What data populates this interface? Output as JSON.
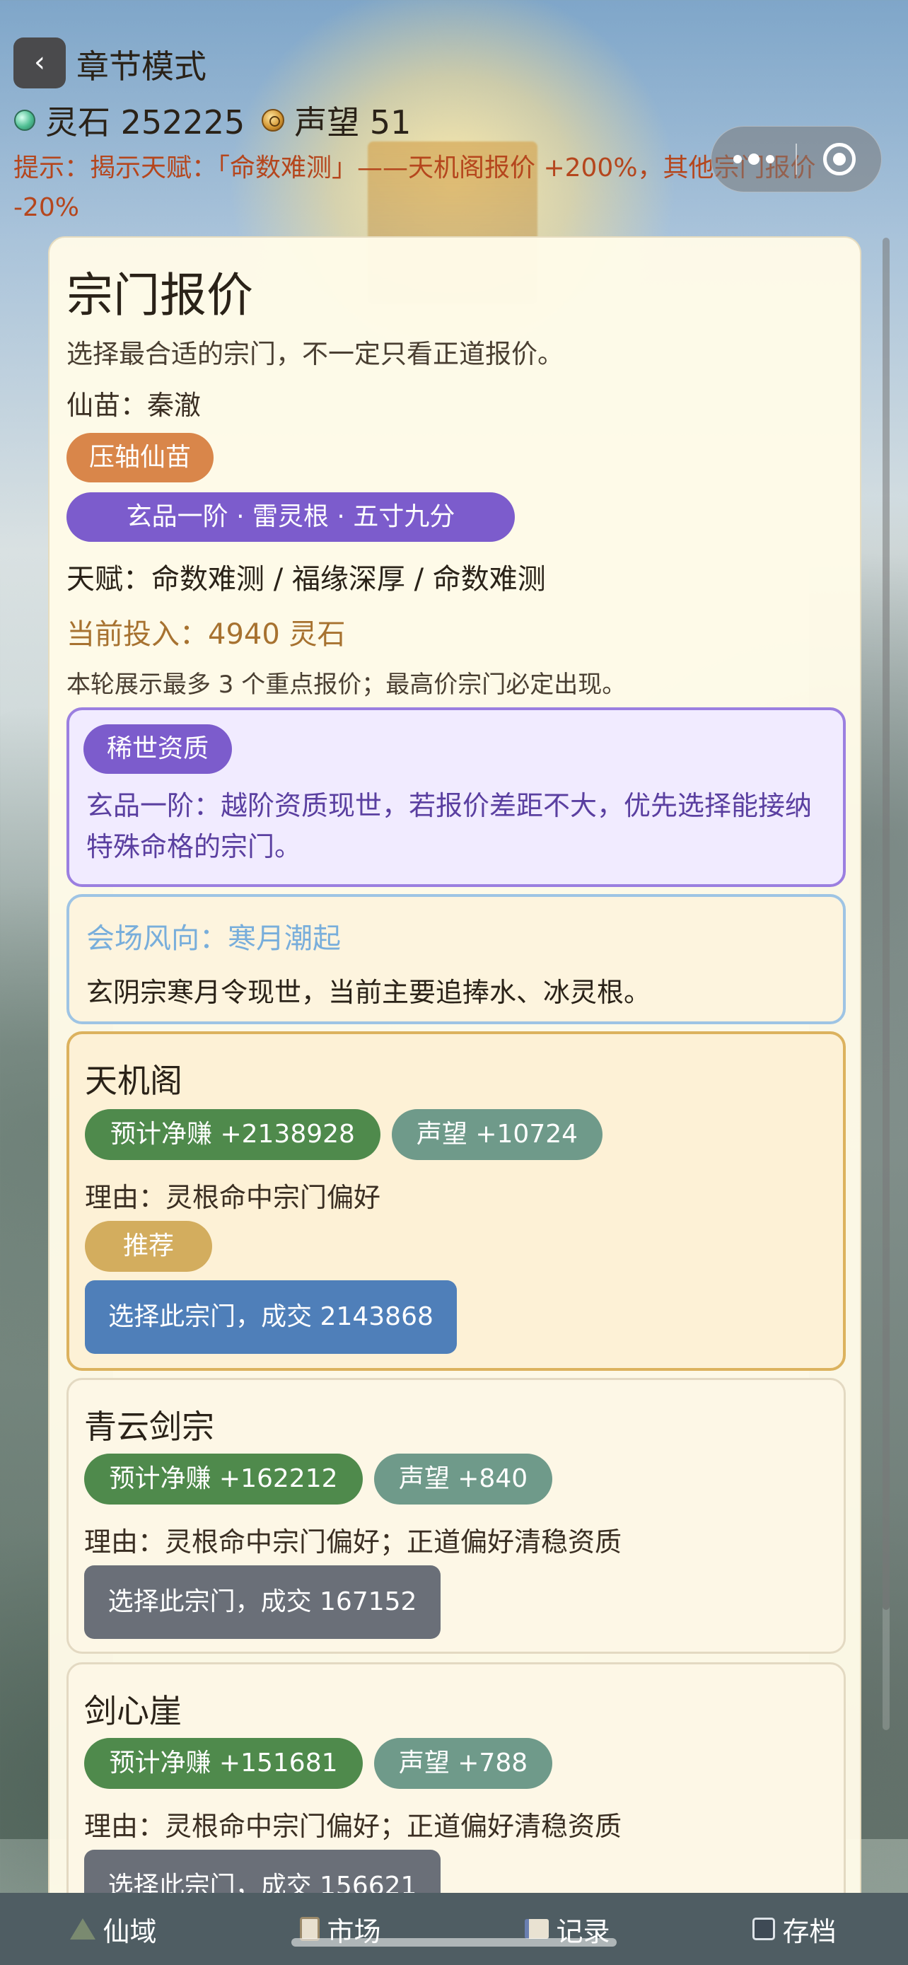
{
  "header": {
    "back_icon": "‹",
    "title": "章节模式",
    "spirit_stones": "灵石 252225",
    "reputation": "声望 51",
    "hint": "提示：揭示天赋：「命数难测」——天机阁报价 +200%，其他宗门报价 -20%"
  },
  "panel": {
    "title": "宗门报价",
    "description": "选择最合适的宗门，不一定只看正道报价。",
    "seedling": "仙苗：秦澈",
    "tag_primary": "压轴仙苗",
    "tag_grade": "玄品一阶 · 雷灵根 · 五寸九分",
    "talents": "天赋：命数难测 / 福缘深厚 / 命数难测",
    "current_invest": "当前投入：4940 灵石",
    "note": "本轮展示最多 3 个重点报价；最高价宗门必定出现。",
    "rare": {
      "badge": "稀世资质",
      "text": "玄品一阶：越阶资质现世，若报价差距不大，优先选择能接纳特殊命格的宗门。"
    },
    "wind": {
      "title": "会场风向：寒月潮起",
      "text": "玄阴宗寒月令现世，当前主要追捧水、冰灵根。"
    }
  },
  "offers": [
    {
      "name": "天机阁",
      "net": "预计净赚 +2138928",
      "rep": "声望 +10724",
      "reason": "理由：灵根命中宗门偏好",
      "recommend": "推荐",
      "button": "选择此宗门，成交 2143868"
    },
    {
      "name": "青云剑宗",
      "net": "预计净赚 +162212",
      "rep": "声望 +840",
      "reason": "理由：灵根命中宗门偏好；正道偏好清稳资质",
      "button": "选择此宗门，成交 167152"
    },
    {
      "name": "剑心崖",
      "net": "预计净赚 +151681",
      "rep": "声望 +788",
      "reason": "理由：灵根命中宗门偏好；正道偏好清稳资质",
      "button": "选择此宗门，成交 156621"
    }
  ],
  "nav": [
    {
      "label": "仙域",
      "icon": "mountain-icon"
    },
    {
      "label": "市场",
      "icon": "clipboard-icon"
    },
    {
      "label": "记录",
      "icon": "book-icon"
    },
    {
      "label": "存档",
      "icon": "disk-icon"
    }
  ],
  "colors": {
    "purple": "#7c5ccc",
    "orange": "#d9864a",
    "green": "#4f8a4c",
    "teal": "#6f9a8a",
    "gold": "#d3ad5e",
    "blue_button": "#4f7fb9",
    "gray_button": "#6a6f78",
    "hint_red": "#b5461d"
  }
}
